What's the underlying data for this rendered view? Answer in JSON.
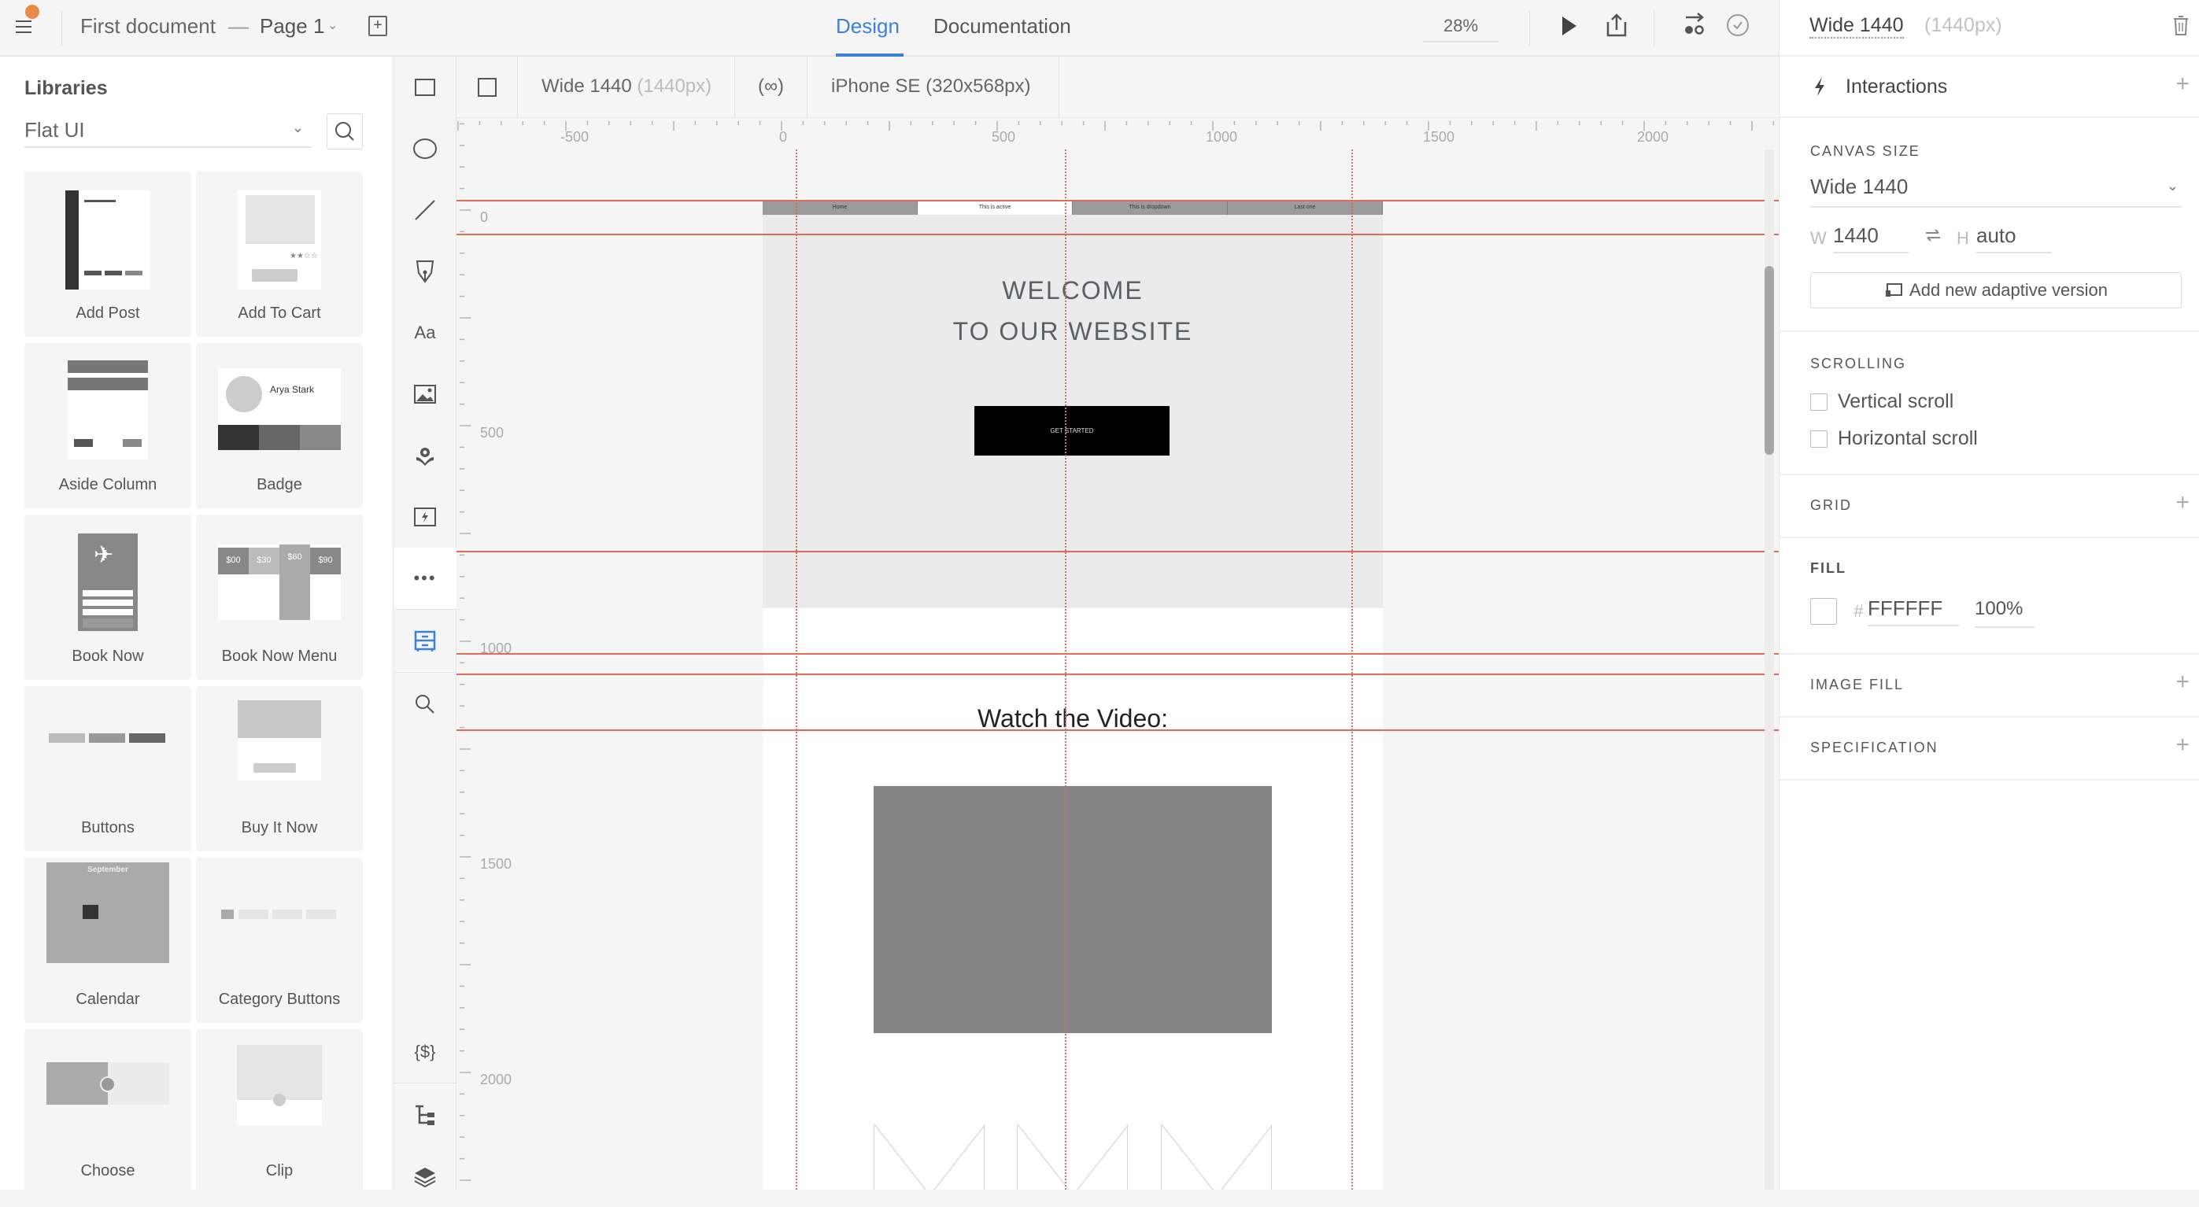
{
  "topbar": {
    "doc_title": "First document",
    "separator": "—",
    "page_name": "Page 1",
    "tabs": [
      {
        "label": "Design",
        "active": true
      },
      {
        "label": "Documentation",
        "active": false
      }
    ],
    "zoom": "28%",
    "accent_color": "#3B82D6",
    "notification_color": "#EA8A4A"
  },
  "libraries": {
    "title": "Libraries",
    "selected_library": "Flat UI",
    "items": [
      {
        "label": "Add Post"
      },
      {
        "label": "Add To Cart"
      },
      {
        "label": "Aside Column"
      },
      {
        "label": "Badge"
      },
      {
        "label": "Book Now"
      },
      {
        "label": "Book Now Menu"
      },
      {
        "label": "Buttons"
      },
      {
        "label": "Buy It Now"
      },
      {
        "label": "Calendar"
      },
      {
        "label": "Category Buttons"
      },
      {
        "label": "Choose"
      },
      {
        "label": "Clip"
      }
    ],
    "thumb_text": {
      "badge_name": "Arya Stark",
      "calendar_month": "September",
      "prices": [
        "$00",
        "$30",
        "$60",
        "$90"
      ]
    }
  },
  "tools": [
    "rectangle",
    "ellipse",
    "line",
    "pen",
    "text",
    "image",
    "icons",
    "interaction",
    "more",
    "library",
    "search",
    "variables",
    "tree",
    "layers"
  ],
  "canvas": {
    "versions": [
      {
        "name": "Wide 1440",
        "size": "(1440px)"
      },
      {
        "name": "iPhone SE (320x568px)",
        "size": ""
      }
    ],
    "link_label": "(∞)",
    "ruler_h": [
      "-500",
      "0",
      "500",
      "1000",
      "1500",
      "2000"
    ],
    "ruler_v": [
      "0",
      "500",
      "1000",
      "1500",
      "2000"
    ],
    "artboard": {
      "nav": [
        "Home",
        "This is active",
        "This is dropdown",
        "Last one"
      ],
      "headline_1": "WELCOME",
      "headline_2": "TO OUR WEBSITE",
      "cta": "GET STARTED",
      "video_heading": "Watch the Video:"
    },
    "guide_color": "#E06B5A"
  },
  "properties": {
    "header_name": "Wide 1440",
    "header_size": "(1440px)",
    "interactions_label": "Interactions",
    "canvas_size_title": "CANVAS SIZE",
    "canvas_size_value": "Wide 1440",
    "w_label": "W",
    "w_value": "1440",
    "h_label": "H",
    "h_value": "auto",
    "adaptive_button": "Add new adaptive version",
    "scrolling_title": "SCROLLING",
    "vertical_scroll": {
      "label": "Vertical scroll",
      "checked": false
    },
    "horizontal_scroll": {
      "label": "Horizontal scroll",
      "checked": false
    },
    "grid_title": "GRID",
    "fill_title": "FILL",
    "fill_hash": "#",
    "fill_hex": "FFFFFF",
    "fill_opacity": "100%",
    "image_fill_title": "IMAGE FILL",
    "specification_title": "SPECIFICATION"
  }
}
